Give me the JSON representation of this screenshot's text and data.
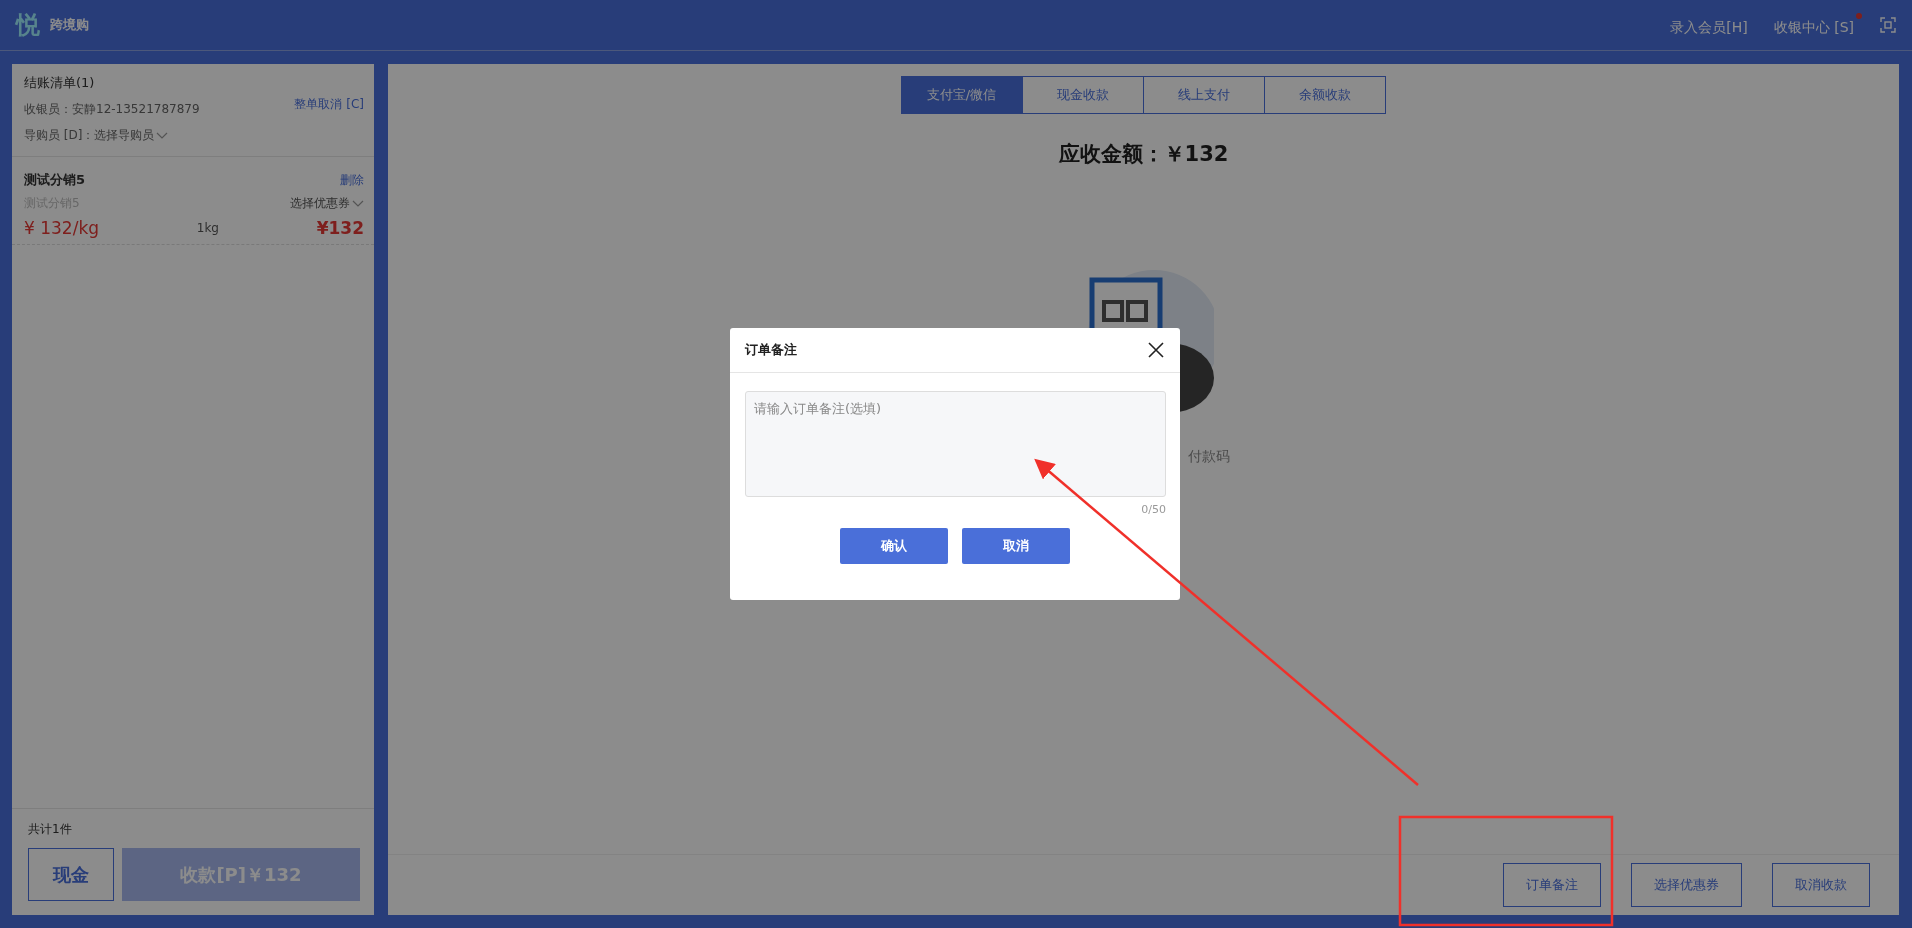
{
  "top_bar": {
    "logo": "悦",
    "app_name": "跨境购",
    "actions": [
      {
        "label": "录入会员[H]",
        "notification": false
      },
      {
        "label": "收银中心 [S]",
        "notification": true
      }
    ]
  },
  "checkout_list": {
    "title": "结账清单(1)",
    "cancel_all": "整单取消 [C]",
    "cashier": "收银员：安静12-13521787879",
    "guide": "导购员 [D]：选择导购员",
    "items": [
      {
        "name": "测试分销5",
        "delete": "删除",
        "subtitle": "测试分销5",
        "coupon": "选择优惠券",
        "unit_price": "¥ 132/kg",
        "quantity": "1kg",
        "total": "¥132"
      }
    ],
    "count": "共计1件",
    "cash_button": "现金",
    "pay_button": "收款[P]￥132"
  },
  "payment": {
    "tabs": [
      {
        "label": "支付宝/微信",
        "selected": true
      },
      {
        "label": "现金收款",
        "selected": false
      },
      {
        "label": "线上支付",
        "selected": false
      },
      {
        "label": "余额收款",
        "selected": false
      }
    ],
    "amount": "应收金额：￥132",
    "scan_hint": "付款码",
    "bottom_buttons": [
      "订单备注",
      "选择优惠券",
      "取消收款"
    ]
  },
  "dialog": {
    "title": "订单备注",
    "placeholder": "请输入订单备注(选填)",
    "counter": "0/50",
    "buttons": [
      "确认",
      "取消"
    ]
  }
}
